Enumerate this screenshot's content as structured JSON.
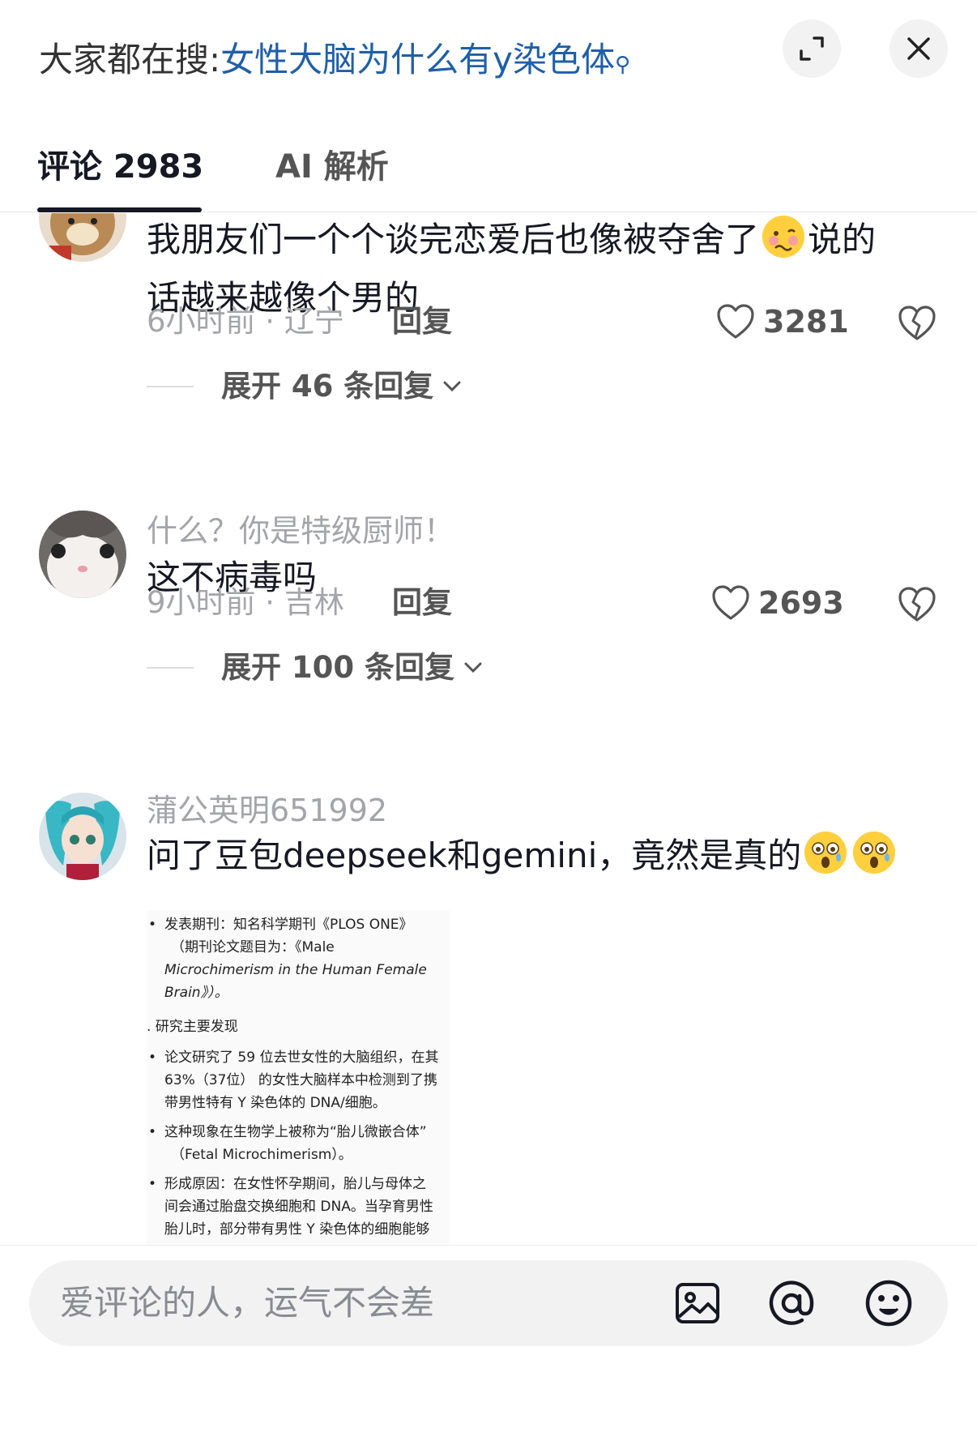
{
  "header": {
    "search_prefix": "大家都在搜:",
    "search_query": "女性大脑为什么有y染色体",
    "expand_icon": "expand-icon",
    "close_icon": "close-icon"
  },
  "tabs": [
    {
      "label": "评论 2983",
      "active": true
    },
    {
      "label": "AI 解析",
      "active": false
    }
  ],
  "comments": [
    {
      "username": "",
      "text_line1": "我朋友们一个个谈完恋爱后也像被夺舍了",
      "text_line1_after": "说的",
      "text_line2": "话越来越像个男的",
      "emoji": "woozy-face-emoji",
      "time_location": "6小时前 · 辽宁",
      "reply_label": "回复",
      "likes": "3281",
      "expand_label": "展开 46 条回复"
    },
    {
      "username": "什么？你是特级厨师！",
      "text_line1": "这不病毒吗",
      "time_location": "9小时前 · 吉林",
      "reply_label": "回复",
      "likes": "2693",
      "expand_label": "展开 100 条回复"
    },
    {
      "username": "蒲公英明651992",
      "text_line1": "问了豆包deepseek和gemini，竟然是真的",
      "emoji": "astonished-face-emoji",
      "attachment": {
        "lines": [
          {
            "type": "bullet",
            "text": "发表期刊：知名科学期刊《PLOS ONE》"
          },
          {
            "type": "cont",
            "text": "（期刊论文题目为：《Male"
          },
          {
            "type": "cont-italic",
            "text": "Microchimerism in the Human Female"
          },
          {
            "type": "cont-italic",
            "text": "Brain》）。"
          },
          {
            "type": "section",
            "text": ". 研究主要发现"
          },
          {
            "type": "bullet",
            "text": "论文研究了 59 位去世女性的大脑组织，在其"
          },
          {
            "type": "cont",
            "text": "63%（37位） 的女性大脑样本中检测到了携"
          },
          {
            "type": "cont",
            "text": "带男性特有 Y 染色体的 DNA/细胞。"
          },
          {
            "type": "bullet",
            "text": "这种现象在生物学上被称为“胎儿微嵌合体”"
          },
          {
            "type": "cont",
            "text": "（Fetal Microchimerism）。"
          },
          {
            "type": "bullet",
            "text": "形成原因：在女性怀孕期间，胎儿与母体之"
          },
          {
            "type": "cont",
            "text": "间会通过胎盘交换细胞和 DNA。当孕育男性"
          },
          {
            "type": "cont",
            "text": "胎儿时，部分带有男性 Y 染色体的细胞能够"
          }
        ]
      }
    }
  ],
  "footer": {
    "placeholder": "爱评论的人，运气不会差",
    "icons": [
      "image-icon",
      "at-mention-icon",
      "emoji-icon"
    ]
  }
}
